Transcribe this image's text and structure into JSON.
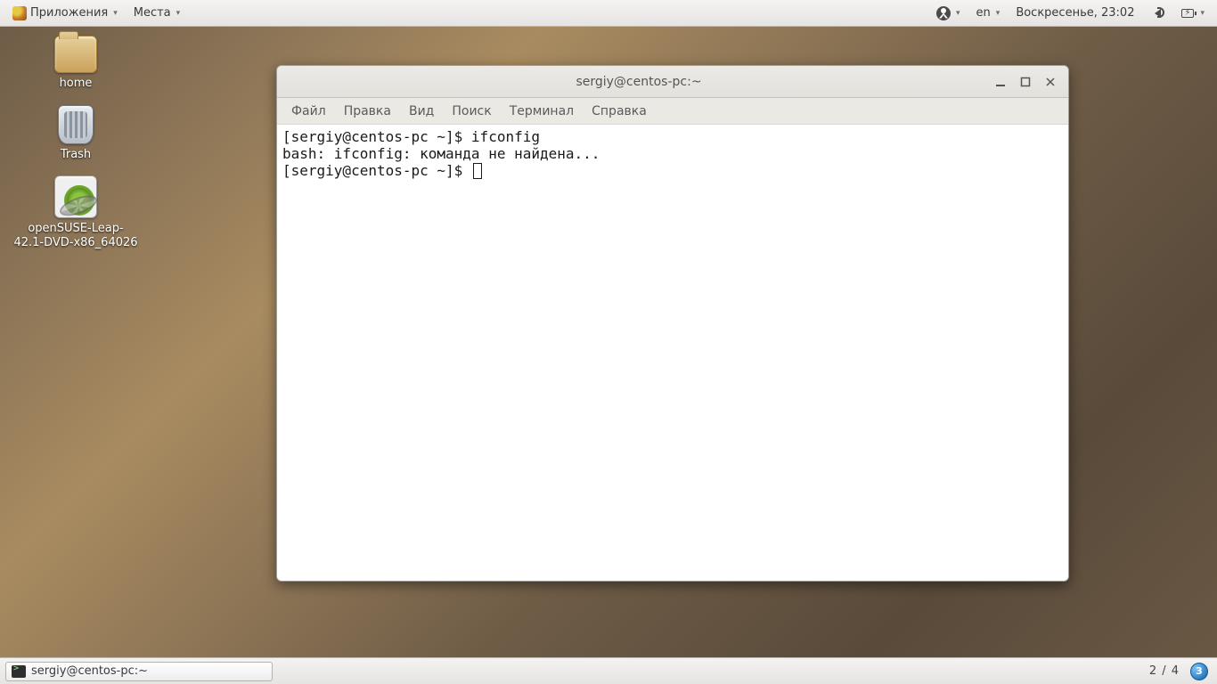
{
  "top_panel": {
    "applications_label": "Приложения",
    "places_label": "Места",
    "lang": "en",
    "clock": "Воскресенье, 23:02"
  },
  "desktop": {
    "icons": [
      {
        "label": "home"
      },
      {
        "label": "Trash"
      },
      {
        "label": "openSUSE-Leap-42.1-DVD-x86_64026"
      }
    ]
  },
  "window": {
    "title": "sergiy@centos-pc:~",
    "menu": {
      "file": "Файл",
      "edit": "Правка",
      "view": "Вид",
      "search": "Поиск",
      "terminal": "Терминал",
      "help": "Справка"
    },
    "terminal_lines": {
      "l0": "[sergiy@centos-pc ~]$ ifconfig",
      "l1": "bash: ifconfig: команда не найдена...",
      "l2": "[sergiy@centos-pc ~]$ "
    }
  },
  "bottom_panel": {
    "task_label": "sergiy@centos-pc:~",
    "workspace": "2 / 4",
    "badge": "3"
  }
}
